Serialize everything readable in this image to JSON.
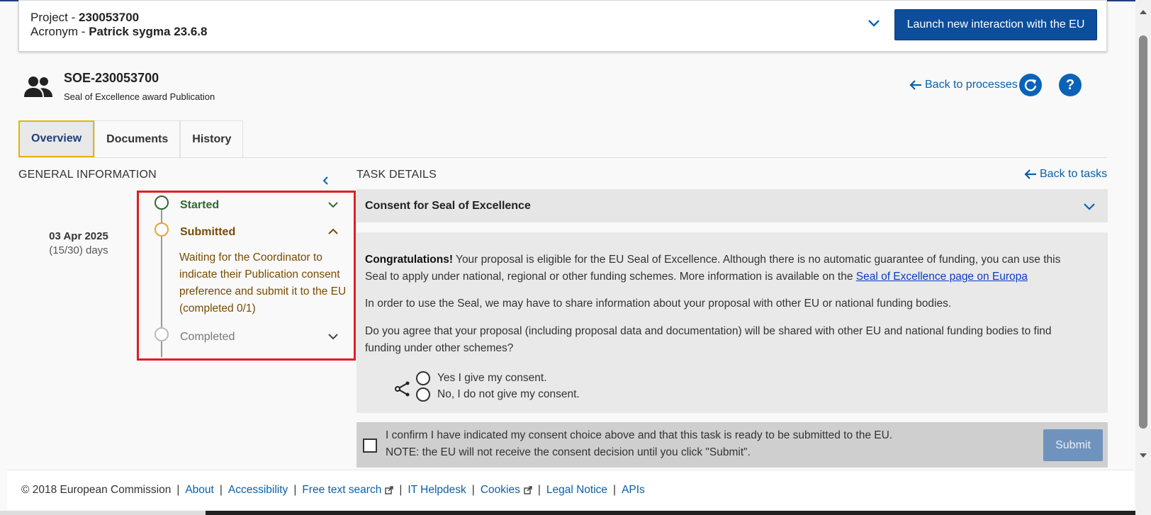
{
  "project": {
    "project_prefix": "Project - ",
    "project_number": "230053700",
    "acronym_prefix": "Acronym - ",
    "acronym_value": "Patrick sygma 23.6.8",
    "launch_button": "Launch new interaction with the EU"
  },
  "process": {
    "title": "SOE-230053700",
    "subtitle": "Seal of Excellence award Publication",
    "back_to_processes": "Back to processes",
    "help_glyph": "?"
  },
  "tabs": [
    {
      "label": "Overview",
      "active": true
    },
    {
      "label": "Documents",
      "active": false
    },
    {
      "label": "History",
      "active": false
    }
  ],
  "general": {
    "heading": "GENERAL INFORMATION",
    "date": "03 Apr 2025",
    "days": "(15/30) days",
    "steps": [
      {
        "label": "Started",
        "color": "#2e6b2e",
        "state": "done"
      },
      {
        "label": "Submitted",
        "color": "#7a4b00",
        "state": "current",
        "description": "Waiting for the Coordinator to indicate their Publication consent preference and submit it to the EU (completed 0/1)"
      },
      {
        "label": "Completed",
        "color": "#777777",
        "state": "pending"
      }
    ]
  },
  "task": {
    "heading": "TASK DETAILS",
    "back_to_tasks": "Back to tasks",
    "title": "Consent for Seal of Excellence",
    "congrats_bold": "Congratulations!",
    "congrats_text": " Your proposal is eligible for the EU Seal of Excellence. Although there is no automatic guarantee of funding, you can use this Seal to apply under national, regional or other funding schemes. More information is available on the ",
    "link_text": "Seal of Excellence page on Europa",
    "para2": "In order to use the Seal, we may have to share information about your proposal with other EU or national funding bodies.",
    "para3": "Do you agree that your proposal (including proposal data and documentation) will be shared with other EU and national funding bodies to find funding under other schemes?",
    "option_yes": "Yes I give my consent.",
    "option_no": "No, I do not give my consent.",
    "confirm_line1": "I confirm I have indicated my consent choice above and that this task is ready to be submitted to the EU.",
    "confirm_line2": "NOTE: the EU will not receive the consent decision until you click \"Submit\".",
    "submit": "Submit"
  },
  "footer": {
    "copyright": "© 2018 European Commission",
    "links": [
      "About",
      "Accessibility",
      "Free text search",
      "IT Helpdesk",
      "Cookies",
      "Legal Notice",
      "APIs"
    ]
  },
  "colors": {
    "primary": "#0c4d9c",
    "link": "#0b5fa5",
    "highlight_border": "#e11d22",
    "tab_active_border": "#e2b600"
  }
}
